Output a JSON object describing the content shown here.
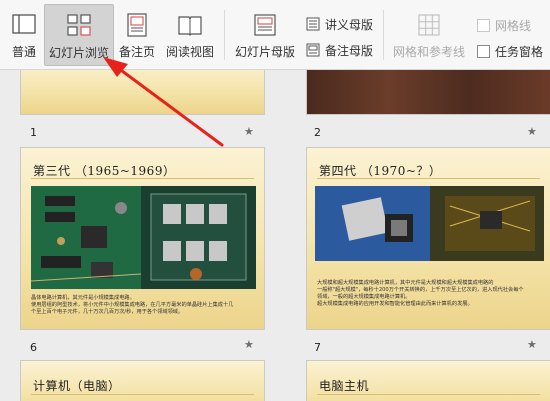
{
  "ribbon": {
    "normal_label": "普通",
    "sorter_label": "幻灯片浏览",
    "notes_label": "备注页",
    "reading_label": "阅读视图",
    "slide_master_label": "幻灯片母版",
    "handout_master_label": "讲义母版",
    "notes_master_label": "备注母版",
    "grid_label": "网格和参考线",
    "gridlines_label": "网格线",
    "task_pane_label": "任务窗格"
  },
  "slides": [
    {
      "number": "1",
      "title": ""
    },
    {
      "number": "2",
      "title": ""
    },
    {
      "number": "6",
      "title": "第三代 （1965~1969）",
      "body": [
        "晶体电路计算机，其元件是小规模集成电路。",
        "使用层组的阿型技术，将小元件中小规模集成电路，在几平方毫米的单晶硅片上集成十几",
        "个至上百个电子元件，几十万次几百万次/秒，用于各个领域领域。"
      ]
    },
    {
      "number": "7",
      "title": "第四代 （1970~？）",
      "body": [
        "大规模和超大规模集成电路计算机，其中元件是大规模和超大规模集成电路的",
        "一般称\"超大规模\"，每秒十200万个开关转换的，上千万次至上亿次的，进入现代社会每个",
        "领域，一般的超大规模集成电路计算机。",
        "超大规模集成电路的应用开发和智能化管理由此而来计算机的发展。"
      ]
    },
    {
      "number": "",
      "title": "计算机（电脑）"
    },
    {
      "number": "",
      "title": "电脑主机"
    }
  ],
  "colors": {
    "active_bg": "#d3d3d3",
    "arrow": "#e8221b",
    "slide_bg": "#f4e3a8"
  }
}
